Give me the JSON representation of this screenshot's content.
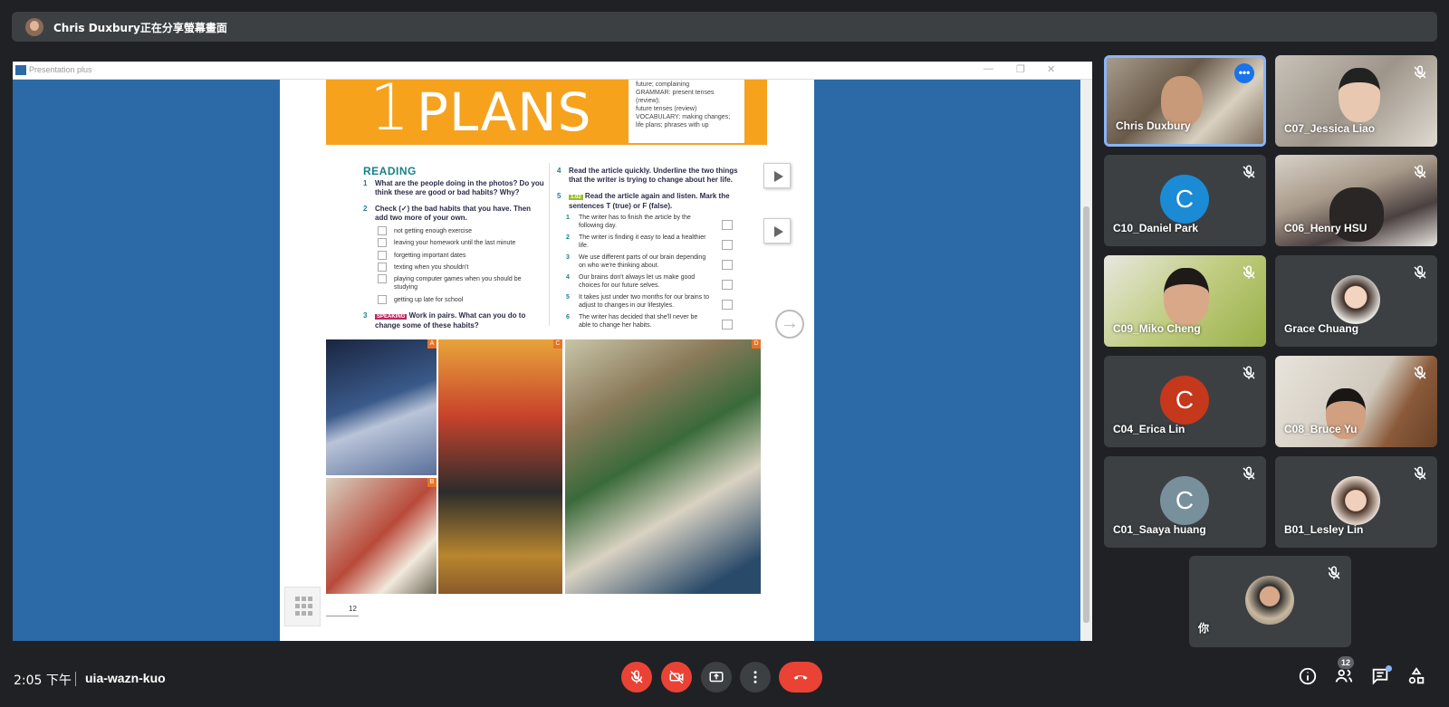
{
  "presenting_banner": {
    "text": "Chris Duxbury正在分享螢幕畫面"
  },
  "window": {
    "title": "Presentation plus",
    "minimize": "—",
    "restore": "❐",
    "close": "✕"
  },
  "book": {
    "unit_number": "1",
    "unit_title": "PLANS",
    "info_lines": [
      "future; complaining",
      "GRAMMAR: present tenses (review);",
      "future tenses (review)",
      "VOCABULARY: making changes;",
      "life plans; phrases with up"
    ],
    "reading_heading": "READING",
    "q1_num": "1",
    "q1": "What are the people doing in the photos? Do you think these are good or bad habits? Why?",
    "q2_num": "2",
    "q2": "Check (✓) the bad habits that you have. Then add two more of your own.",
    "habits": [
      "not getting enough exercise",
      "leaving your homework until the last minute",
      "forgetting important dates",
      "texting when you shouldn't",
      "playing computer games when you should be studying",
      "getting up late for school"
    ],
    "q3_num": "3",
    "q3_tag": "SPEAKING",
    "q3": "Work in pairs. What can you do to change some of these habits?",
    "q4_num": "4",
    "q4": "Read the article quickly. Underline the two things that the writer is trying to change about her life.",
    "q5_num": "5",
    "q5_tag": "1.02",
    "q5": "Read the article again and listen. Mark the sentences T (true) or F (false).",
    "statements": [
      {
        "n": "1",
        "text": "The writer has to finish the article by the following day."
      },
      {
        "n": "2",
        "text": "The writer is finding it easy to lead a healthier life."
      },
      {
        "n": "3",
        "text": "We use different parts of our brain depending on who we're thinking about."
      },
      {
        "n": "4",
        "text": "Our brains don't always let us make good choices for our future selves."
      },
      {
        "n": "5",
        "text": "It takes just under two months for our brains to adjust to changes in our lifestyles."
      },
      {
        "n": "6",
        "text": "The writer has decided that she'll never be able to change her habits."
      }
    ],
    "photo_labels": [
      "A",
      "B",
      "C",
      "D"
    ],
    "page_number": "12"
  },
  "participants": [
    {
      "name": "Chris Duxbury",
      "video": true,
      "active": true
    },
    {
      "name": "C07_Jessica Liao",
      "video": true,
      "muted": true
    },
    {
      "name": "C10_Daniel Park",
      "initial": "C",
      "color": "#1a8bd4",
      "muted": true
    },
    {
      "name": "C06_Henry HSU",
      "video": true,
      "muted": true
    },
    {
      "name": "C09_Miko Cheng",
      "video": true,
      "muted": true
    },
    {
      "name": "Grace Chuang",
      "photo": true,
      "muted": true
    },
    {
      "name": "C04_Erica Lin",
      "initial": "C",
      "color": "#c5381b",
      "muted": true
    },
    {
      "name": "C08_Bruce Yu",
      "video": true,
      "muted": true
    },
    {
      "name": "C01_Saaya huang",
      "initial": "C",
      "color": "#78909c",
      "muted": true
    },
    {
      "name": "B01_Lesley Lin",
      "photo": true,
      "muted": true
    },
    {
      "name": "你",
      "photo": true,
      "muted": true
    }
  ],
  "bottom": {
    "time": "2:05 下午",
    "meeting_code": "uia-wazn-kuo",
    "people_count": "12"
  },
  "icons": [
    "mic-off-icon",
    "camera-off-icon",
    "present-icon",
    "more-icon",
    "leave-call-icon",
    "info-icon",
    "people-icon",
    "chat-icon",
    "activities-icon"
  ],
  "colors": {
    "background": "#202124",
    "tile": "#3c4043",
    "danger": "#ea4335",
    "accent": "#8ab4f8",
    "book_banner": "#f6a21d",
    "share_bg": "#2b6aa6"
  }
}
